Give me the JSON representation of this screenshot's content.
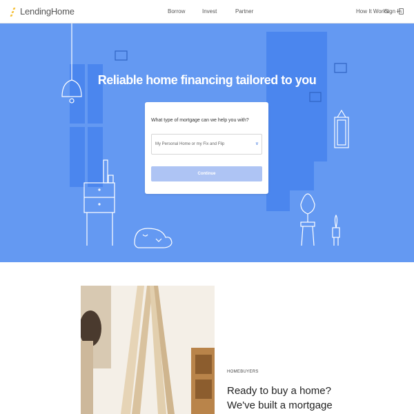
{
  "header": {
    "logo_text": "LendingHome",
    "nav": [
      "Borrow",
      "Invest",
      "Partner"
    ],
    "right_links": [
      "How It Works",
      "Sign In"
    ]
  },
  "hero": {
    "title": "Reliable home financing tailored to you",
    "form": {
      "question": "What type of mortgage can we help you with?",
      "select_value": "My Personal Home or my Fix and Flip",
      "continue_label": "Continue"
    }
  },
  "section": {
    "eyebrow": "HOMEBUYERS",
    "headline": "Ready to buy a home? We've built a mortgage process that has you"
  },
  "colors": {
    "hero_bg": "#6499f2",
    "hero_dark_blocks": "#4b86ee",
    "button_disabled": "#aec4f4",
    "logo_accent": "#f6c23d"
  },
  "icons": [
    "logo-mark-icon",
    "sign-in-icon",
    "chevron-down-icon"
  ]
}
